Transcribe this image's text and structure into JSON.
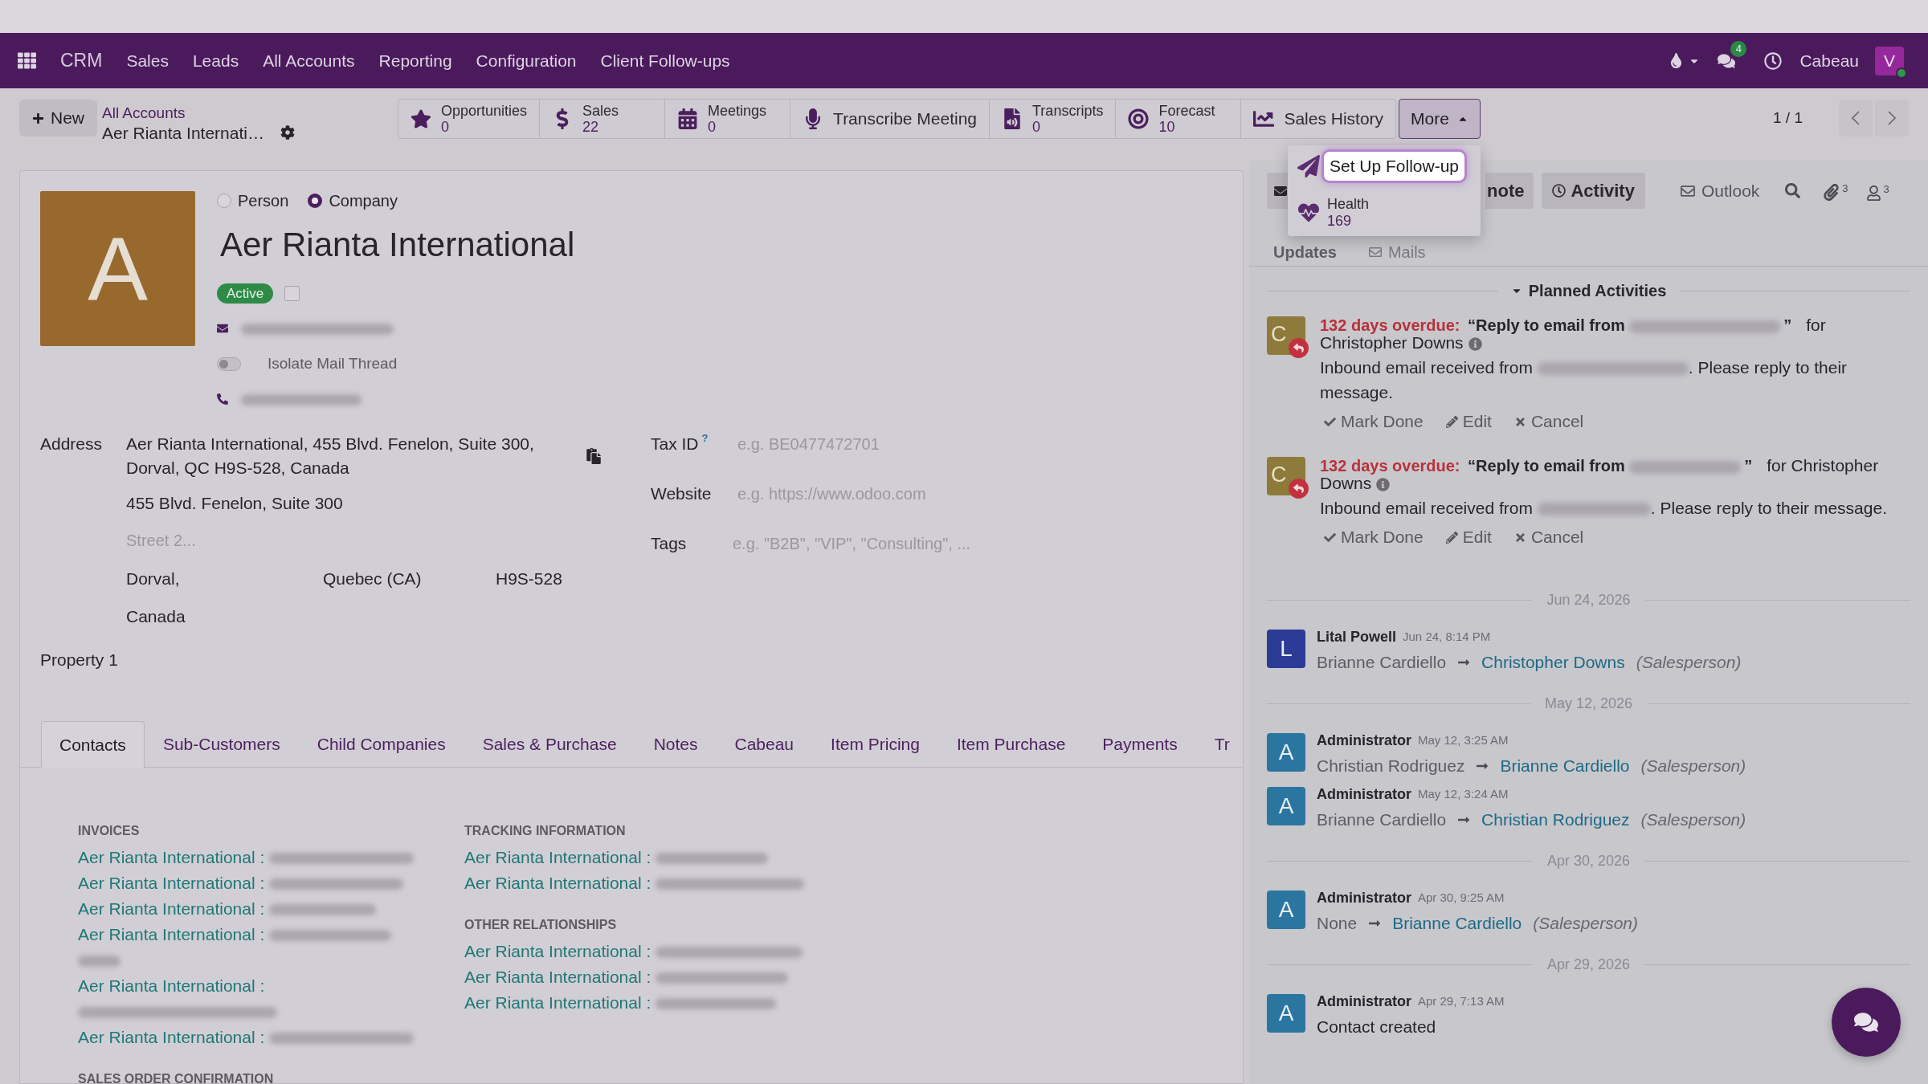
{
  "navbar": {
    "app_name": "CRM",
    "menu": [
      "Sales",
      "Leads",
      "All Accounts",
      "Reporting",
      "Configuration",
      "Client Follow-ups"
    ],
    "messages_badge": "4",
    "company": "Cabeau",
    "user_initial": "V"
  },
  "control_panel": {
    "new_button": "New",
    "breadcrumb": {
      "parent": "All Accounts",
      "current": "Aer Rianta Internati…"
    },
    "smart_buttons": [
      {
        "kind": "stat",
        "label": "Opportunities",
        "value": "0"
      },
      {
        "kind": "stat",
        "label": "Sales",
        "value": "22"
      },
      {
        "kind": "stat",
        "label": "Meetings",
        "value": "0"
      },
      {
        "kind": "action",
        "label": "Transcribe Meeting"
      },
      {
        "kind": "stat",
        "label": "Transcripts",
        "value": "0"
      },
      {
        "kind": "stat",
        "label": "Forecast",
        "value": "10"
      },
      {
        "kind": "action",
        "label": "Sales History"
      }
    ],
    "more": {
      "label": "More",
      "expanded": true,
      "items": [
        {
          "kind": "action",
          "label": "Set Up Follow-up",
          "highlighted": true
        },
        {
          "kind": "stat",
          "label": "Health",
          "value": "169",
          "highlighted": false
        }
      ]
    },
    "pager": "1 / 1"
  },
  "form": {
    "avatar_initial": "A",
    "company_type": [
      {
        "label": "Person",
        "selected": false
      },
      {
        "label": "Company",
        "selected": true
      }
    ],
    "name": "Aer Rianta International",
    "status": "Active",
    "checkbox": {
      "checked": false
    },
    "isolate_mail_thread": {
      "label": "Isolate Mail Thread",
      "on": false
    },
    "address": {
      "label": "Address",
      "summary": "Aer Rianta International, 455 Blvd. Fenelon, Suite 300, Dorval, QC H9S-528, Canada",
      "street": "455 Blvd. Fenelon, Suite 300",
      "street2_placeholder": "Street 2...",
      "city": "Dorval,",
      "state": "Quebec (CA)",
      "zip": "H9S-528",
      "country": "Canada"
    },
    "tax_id": {
      "label": "Tax ID",
      "help": "?",
      "placeholder": "e.g. BE0477472701"
    },
    "website": {
      "label": "Website",
      "placeholder": "e.g. https://www.odoo.com"
    },
    "tags": {
      "label": "Tags",
      "placeholder": "e.g. \"B2B\", \"VIP\", \"Consulting\", ..."
    },
    "property": "Property 1",
    "tabs": [
      {
        "label": "Contacts",
        "selected": true
      },
      {
        "label": "Sub-Customers",
        "selected": false
      },
      {
        "label": "Child Companies",
        "selected": false
      },
      {
        "label": "Sales & Purchase",
        "selected": false
      },
      {
        "label": "Notes",
        "selected": false
      },
      {
        "label": "Cabeau",
        "selected": false
      },
      {
        "label": "Item Pricing",
        "selected": false
      },
      {
        "label": "Item Purchase",
        "selected": false
      },
      {
        "label": "Payments",
        "selected": false
      },
      {
        "label": "Tr",
        "selected": false
      }
    ],
    "contacts": {
      "columns": [
        {
          "sections": [
            {
              "heading": "INVOICES",
              "links": [
                "Aer Rianta International :",
                "Aer Rianta International :",
                "Aer Rianta International :",
                "Aer Rianta International :",
                "Aer Rianta International :",
                "Aer Rianta International :"
              ]
            },
            {
              "heading": "SALES ORDER CONFIRMATION"
            }
          ]
        },
        {
          "sections": [
            {
              "heading": "TRACKING INFORMATION",
              "links": [
                "Aer Rianta International :",
                "Aer Rianta International :"
              ]
            },
            {
              "heading": "OTHER RELATIONSHIPS",
              "links": [
                "Aer Rianta International :",
                "Aer Rianta International :",
                "Aer Rianta International :"
              ]
            }
          ]
        }
      ]
    }
  },
  "chatter": {
    "log_note_button": "note",
    "activity_button": "Activity",
    "outlook_button": "Outlook",
    "attachments_count": "3",
    "followers_count": "3",
    "thread_tabs": [
      {
        "label": "Updates",
        "selected": true
      },
      {
        "label": "Mails",
        "selected": false
      }
    ],
    "planned_activities": {
      "title": "Planned Activities",
      "expanded": true,
      "items": [
        {
          "avatar": "C",
          "overdue": "132 days overdue:",
          "summary": "“Reply to email from",
          "summary_end": "”",
          "assignee": "for Christopher Downs",
          "note": "Inbound email received from",
          "note_end": ". Please reply to their message.",
          "actions": [
            {
              "kind": "done",
              "label": "Mark Done"
            },
            {
              "kind": "edit",
              "label": "Edit"
            },
            {
              "kind": "cancel",
              "label": "Cancel"
            }
          ]
        },
        {
          "avatar": "C",
          "overdue": "132 days overdue:",
          "summary": "“Reply to email from",
          "summary_end": "”",
          "assignee": "for Christopher Downs",
          "note": "Inbound email received from",
          "note_end": ". Please reply to their message.",
          "actions": [
            {
              "kind": "done",
              "label": "Mark Done"
            },
            {
              "kind": "edit",
              "label": "Edit"
            },
            {
              "kind": "cancel",
              "label": "Cancel"
            }
          ]
        }
      ]
    },
    "message_groups": [
      {
        "date": "Jun 24, 2026",
        "messages": [
          {
            "author": "Lital Powell",
            "avatar": "L",
            "color": "#2c3b96",
            "time": "Jun 24, 8:14 PM",
            "kind": "tracking",
            "old_value": "Brianne Cardiello",
            "new_value": "Christopher Downs",
            "field": "(Salesperson)"
          }
        ]
      },
      {
        "date": "May 12, 2026",
        "messages": [
          {
            "author": "Administrator",
            "avatar": "A",
            "color": "#2a76a0",
            "time": "May 12, 3:25 AM",
            "kind": "tracking",
            "old_value": "Christian Rodriguez",
            "new_value": "Brianne Cardiello",
            "field": "(Salesperson)"
          },
          {
            "author": "Administrator",
            "avatar": "A",
            "color": "#2a76a0",
            "time": "May 12, 3:24 AM",
            "kind": "tracking",
            "old_value": "Brianne Cardiello",
            "new_value": "Christian Rodriguez",
            "field": "(Salesperson)"
          }
        ]
      },
      {
        "date": "Apr 30, 2026",
        "messages": [
          {
            "author": "Administrator",
            "avatar": "A",
            "color": "#2a76a0",
            "time": "Apr 30, 9:25 AM",
            "kind": "tracking",
            "old_value": "None",
            "new_value": "Brianne Cardiello",
            "field": "(Salesperson)"
          }
        ]
      },
      {
        "date": "Apr 29, 2026",
        "messages": [
          {
            "author": "Administrator",
            "avatar": "A",
            "color": "#2a76a0",
            "time": "Apr 29, 7:13 AM",
            "kind": "text",
            "body": "Contact created"
          }
        ]
      }
    ]
  }
}
